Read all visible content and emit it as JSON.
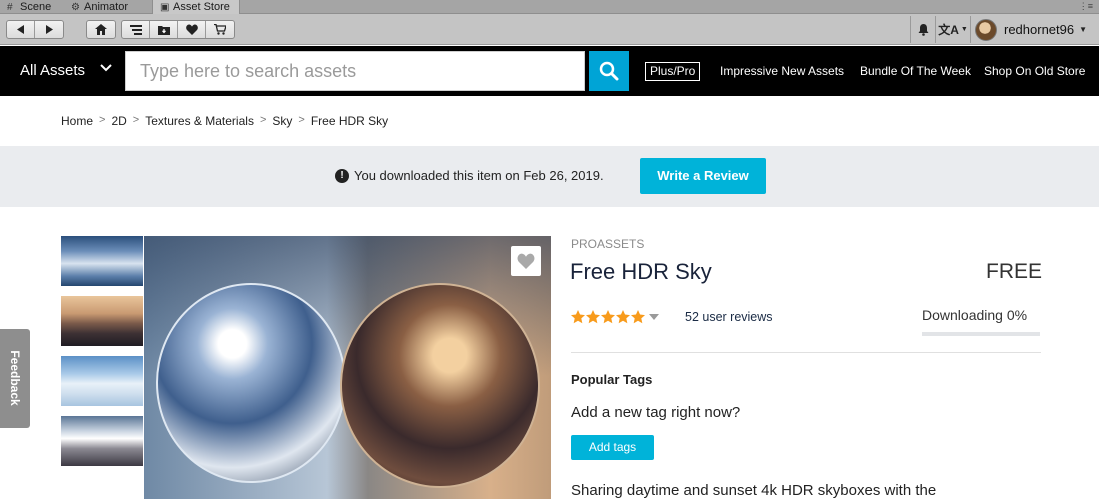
{
  "editor": {
    "tabs": [
      {
        "label": "Scene",
        "icon": "grid-icon"
      },
      {
        "label": "Animator",
        "icon": "animator-icon"
      },
      {
        "label": "Asset Store",
        "icon": "store-icon"
      }
    ],
    "toolbar": {
      "nav_buttons": [
        "back-icon",
        "forward-icon"
      ],
      "tool_buttons": [
        "home-icon",
        "list-icon",
        "folder-download-icon",
        "heart-icon",
        "cart-icon"
      ],
      "right_icons": [
        "bell-icon",
        "translate-icon"
      ],
      "username": "redhornet96"
    }
  },
  "nav": {
    "all_assets": "All Assets",
    "search_placeholder": "Type here to search assets",
    "plus_pro": "Plus/Pro",
    "links": [
      "Impressive New Assets",
      "Bundle Of The Week",
      "Shop On Old Store"
    ]
  },
  "breadcrumb": [
    "Home",
    "2D",
    "Textures & Materials",
    "Sky",
    "Free HDR Sky"
  ],
  "notice": {
    "text": "You downloaded this item on Feb 26, 2019.",
    "button": "Write a Review"
  },
  "product": {
    "publisher": "PROASSETS",
    "title": "Free HDR Sky",
    "price": "FREE",
    "rating": 5,
    "reviews": "52 user reviews",
    "downloading": "Downloading 0%",
    "progress": 0,
    "popular_tags": "Popular Tags",
    "add_tag_prompt": "Add a new tag right now?",
    "add_tags_button": "Add tags",
    "description": "Sharing daytime and sunset 4k HDR skyboxes with the"
  },
  "feedback": "Feedback",
  "colors": {
    "accent": "#00b3d9",
    "search_button": "#00a4d6",
    "star": "#f89b1c",
    "navbar": "#000000",
    "notice_bg": "#eaecef"
  }
}
